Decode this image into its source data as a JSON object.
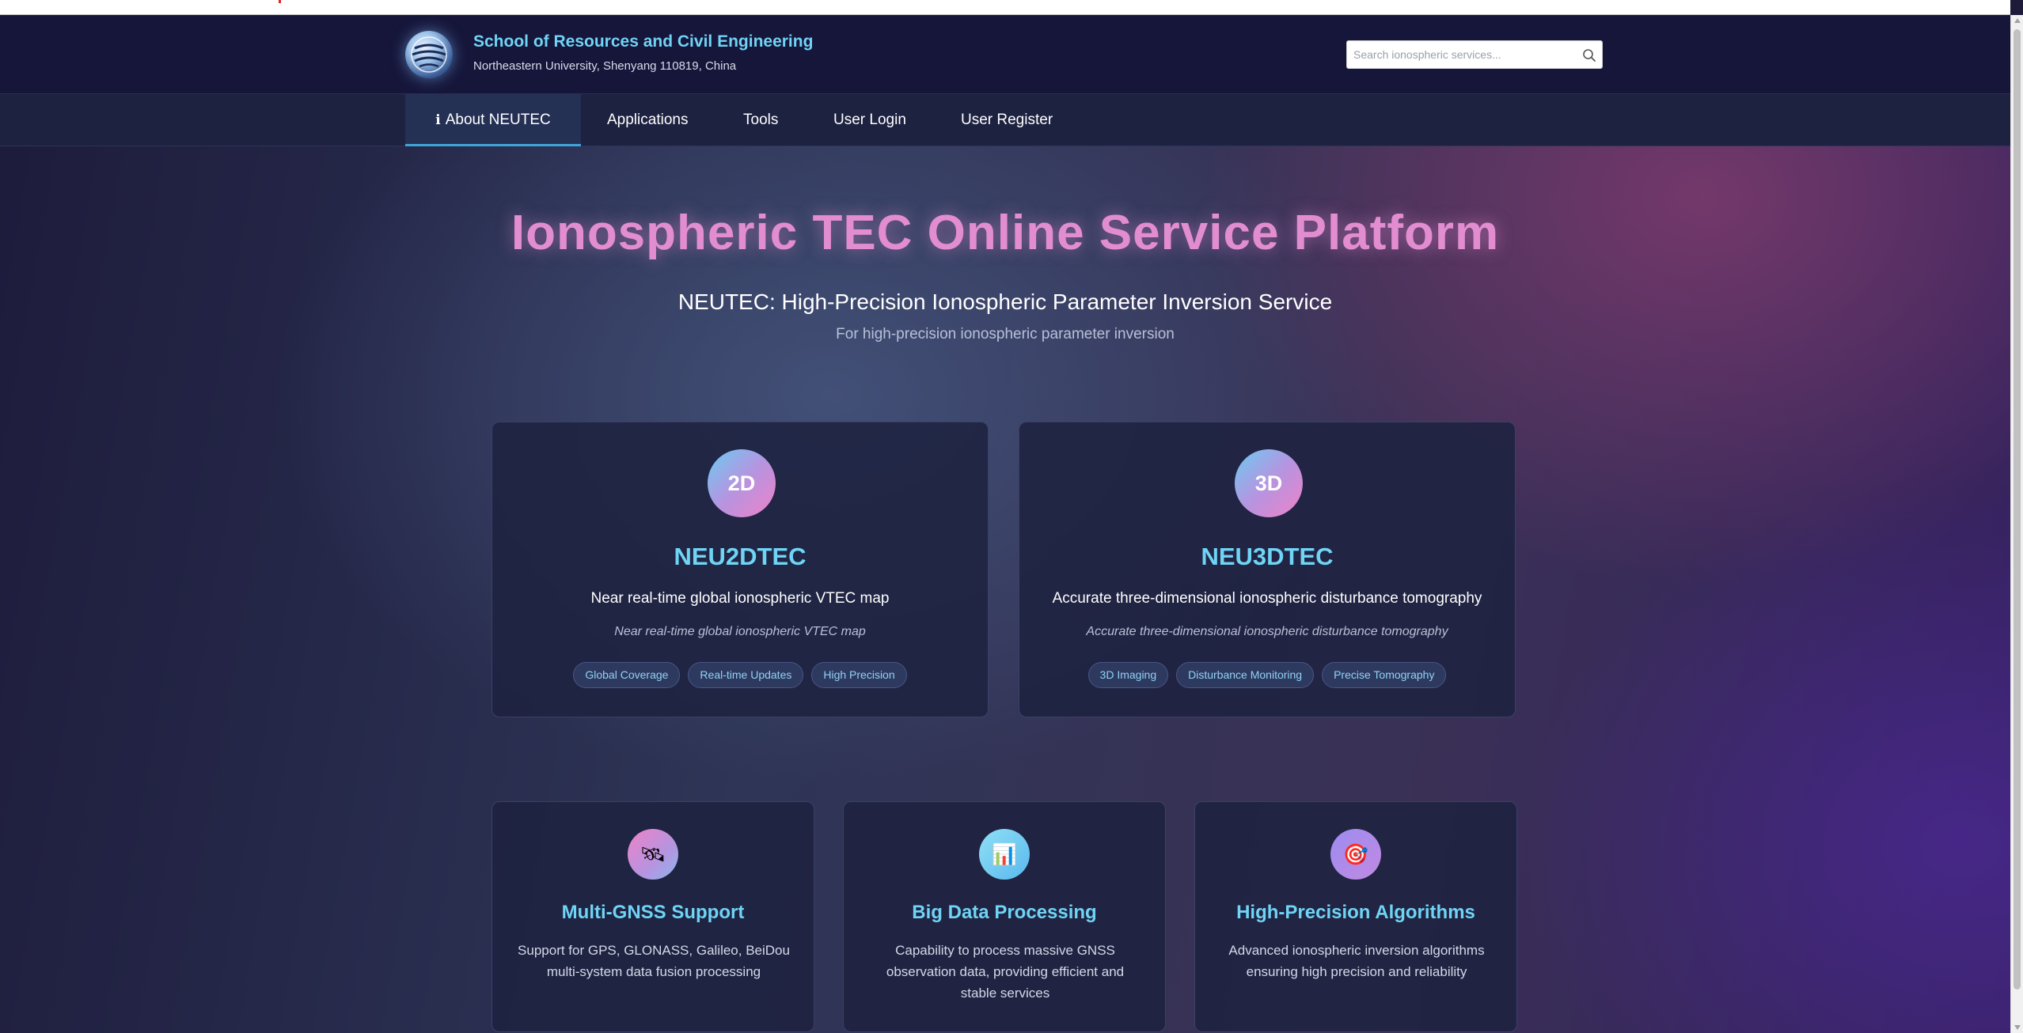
{
  "header": {
    "school_name": "School of Resources and Civil Engineering",
    "address": "Northeastern University, Shenyang 110819, China",
    "search_placeholder": "Search ionospheric services..."
  },
  "nav": {
    "items": [
      {
        "label": "About NEUTEC",
        "active": true,
        "icon": "info-icon"
      },
      {
        "label": "Applications"
      },
      {
        "label": "Tools"
      },
      {
        "label": "User Login"
      },
      {
        "label": "User Register"
      }
    ]
  },
  "hero": {
    "title": "Ionospheric TEC Online Service Platform",
    "subtitle": "NEUTEC: High-Precision Ionospheric Parameter Inversion Service",
    "tagline": "For high-precision ionospheric parameter inversion"
  },
  "products": [
    {
      "badge": "2D",
      "title": "NEU2DTEC",
      "description": "Near real-time global ionospheric VTEC map",
      "note": "Near real-time global ionospheric VTEC map",
      "tags": [
        "Global Coverage",
        "Real-time Updates",
        "High Precision"
      ]
    },
    {
      "badge": "3D",
      "title": "NEU3DTEC",
      "description": "Accurate three-dimensional ionospheric disturbance tomography",
      "note": "Accurate three-dimensional ionospheric disturbance tomography",
      "tags": [
        "3D Imaging",
        "Disturbance Monitoring",
        "Precise Tomography"
      ]
    }
  ],
  "features": [
    {
      "icon": "satellite-icon",
      "icon_glyph": "🛰",
      "title": "Multi-GNSS Support",
      "description": "Support for GPS, GLONASS, Galileo, BeiDou multi-system data fusion processing"
    },
    {
      "icon": "bar-chart-icon",
      "icon_glyph": "📊",
      "title": "Big Data Processing",
      "description": "Capability to process massive GNSS observation data, providing efficient and stable services"
    },
    {
      "icon": "target-icon",
      "icon_glyph": "🎯",
      "title": "High-Precision Algorithms",
      "description": "Advanced ionospheric inversion algorithms ensuring high precision and reliability"
    }
  ],
  "colors": {
    "accent_cyan": "#6fd4f5",
    "title_pink": "#e28dd0",
    "header_bg": "#16163a",
    "nav_active_border": "#3fa4d8"
  }
}
